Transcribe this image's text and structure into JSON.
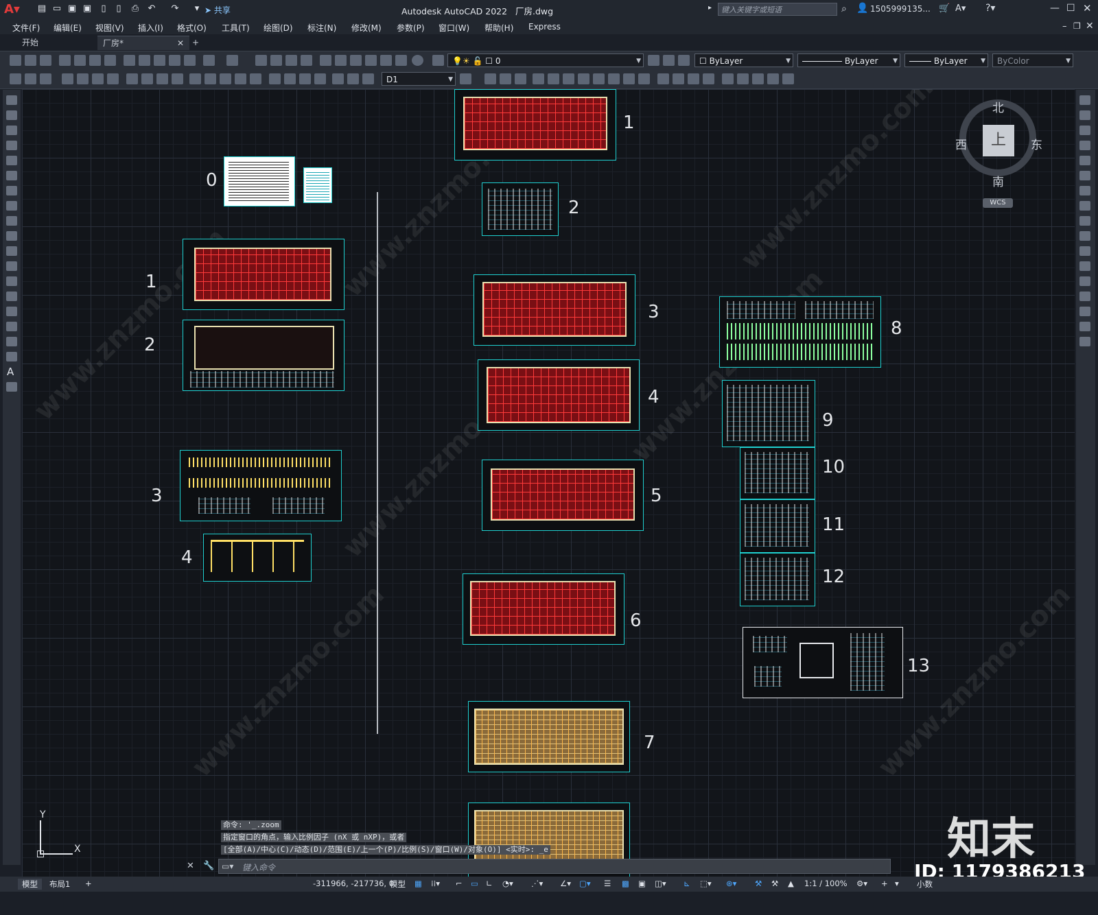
{
  "app": {
    "title": "Autodesk AutoCAD 2022",
    "file": "厂房.dwg",
    "search_placeholder": "键入关键字或短语",
    "user": "1505999135...",
    "share": "共享"
  },
  "menu": [
    "文件(F)",
    "编辑(E)",
    "视图(V)",
    "插入(I)",
    "格式(O)",
    "工具(T)",
    "绘图(D)",
    "标注(N)",
    "修改(M)",
    "参数(P)",
    "窗口(W)",
    "帮助(H)",
    "Express"
  ],
  "tabs": {
    "start": "开始",
    "doc": "厂房*",
    "add": "+"
  },
  "toolbar": {
    "layer": "0",
    "color": "ByLayer",
    "linetype": "ByLayer",
    "lineweight": "ByLayer",
    "plotstyle": "ByColor",
    "dimstyle": "D1"
  },
  "viewcube": {
    "top": "上",
    "north": "北",
    "south": "南",
    "east": "东",
    "west": "西",
    "wcs": "WCS"
  },
  "sheet_numbers": {
    "left": [
      "0",
      "1",
      "2",
      "3",
      "4"
    ],
    "middle": [
      "1",
      "2",
      "3",
      "4",
      "5",
      "6",
      "7"
    ],
    "right": [
      "8",
      "9",
      "10",
      "11",
      "12",
      "13"
    ]
  },
  "command": {
    "line1": "命令: '_.zoom",
    "line2": "指定窗口的角点，输入比例因子 (nX 或 nXP)，或者",
    "line3": "[全部(A)/中心(C)/动态(D)/范围(E)/上一个(P)/比例(S)/窗口(W)/对象(O)] <实时>: _e",
    "placeholder": "键入命令"
  },
  "ucs": {
    "x": "X",
    "y": "Y"
  },
  "status": {
    "model_tab": "模型",
    "layout_tab": "布局1",
    "add": "+",
    "coords": "-311966, -217736, 0",
    "space": "模型",
    "scale": "1:1 / 100%",
    "units": "小数"
  },
  "watermark": {
    "brand": "知末",
    "id": "ID: 1179386213",
    "site": "www.znzmo.com"
  }
}
